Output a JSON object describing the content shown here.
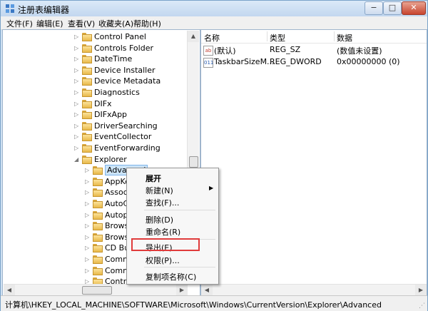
{
  "window": {
    "title": "注册表编辑器",
    "min": "−",
    "max": "□",
    "close": "✕"
  },
  "menu": [
    "文件(F)",
    "编辑(E)",
    "查看(V)",
    "收藏夹(A)",
    "帮助(H)"
  ],
  "tree": {
    "items": [
      {
        "label": "Control Panel",
        "expand": "▷"
      },
      {
        "label": "Controls Folder",
        "expand": "▷"
      },
      {
        "label": "DateTime",
        "expand": "▷"
      },
      {
        "label": "Device Installer",
        "expand": "▷"
      },
      {
        "label": "Device Metadata",
        "expand": "▷"
      },
      {
        "label": "Diagnostics",
        "expand": "▷"
      },
      {
        "label": "DIFx",
        "expand": "▷"
      },
      {
        "label": "DIFxApp",
        "expand": "▷"
      },
      {
        "label": "DriverSearching",
        "expand": "▷"
      },
      {
        "label": "EventCollector",
        "expand": "▷"
      },
      {
        "label": "EventForwarding",
        "expand": "▷"
      },
      {
        "label": "Explorer",
        "expand": "◢"
      },
      {
        "label": "Advanced",
        "expand": "▷"
      },
      {
        "label": "AppKe",
        "expand": "▷"
      },
      {
        "label": "Associ",
        "expand": "▷"
      },
      {
        "label": "AutoCo",
        "expand": "▷"
      },
      {
        "label": "Autopl",
        "expand": "▷"
      },
      {
        "label": "Browse",
        "expand": "▷"
      },
      {
        "label": "Browse",
        "expand": "▷"
      },
      {
        "label": "CD Bu",
        "expand": "▷"
      },
      {
        "label": "Comm",
        "expand": "▷"
      },
      {
        "label": "Comm",
        "expand": "▷"
      },
      {
        "label": "Contro",
        "expand": "▷"
      }
    ]
  },
  "list": {
    "headers": [
      "名称",
      "类型",
      "数据"
    ],
    "rows": [
      {
        "icon": "ab",
        "name": "(默认)",
        "type": "REG_SZ",
        "data": "(数值未设置)"
      },
      {
        "icon": "011",
        "name": "TaskbarSizeM...",
        "type": "REG_DWORD",
        "data": "0x00000000 (0)"
      }
    ]
  },
  "context_menu": {
    "items": [
      {
        "label": "展开"
      },
      {
        "label": "新建(N)",
        "submenu": "▶"
      },
      {
        "label": "查找(F)..."
      },
      {
        "label": "删除(D)"
      },
      {
        "label": "重命名(R)"
      },
      {
        "label": "导出(E)"
      },
      {
        "label": "权限(P)..."
      },
      {
        "label": "复制项名称(C)"
      }
    ]
  },
  "status_path": "计算机\\HKEY_LOCAL_MACHINE\\SOFTWARE\\Microsoft\\Windows\\CurrentVersion\\Explorer\\Advanced",
  "scroll": {
    "up": "▲",
    "down": "▼",
    "left": "◀",
    "right": "▶"
  },
  "grip": "⋰"
}
